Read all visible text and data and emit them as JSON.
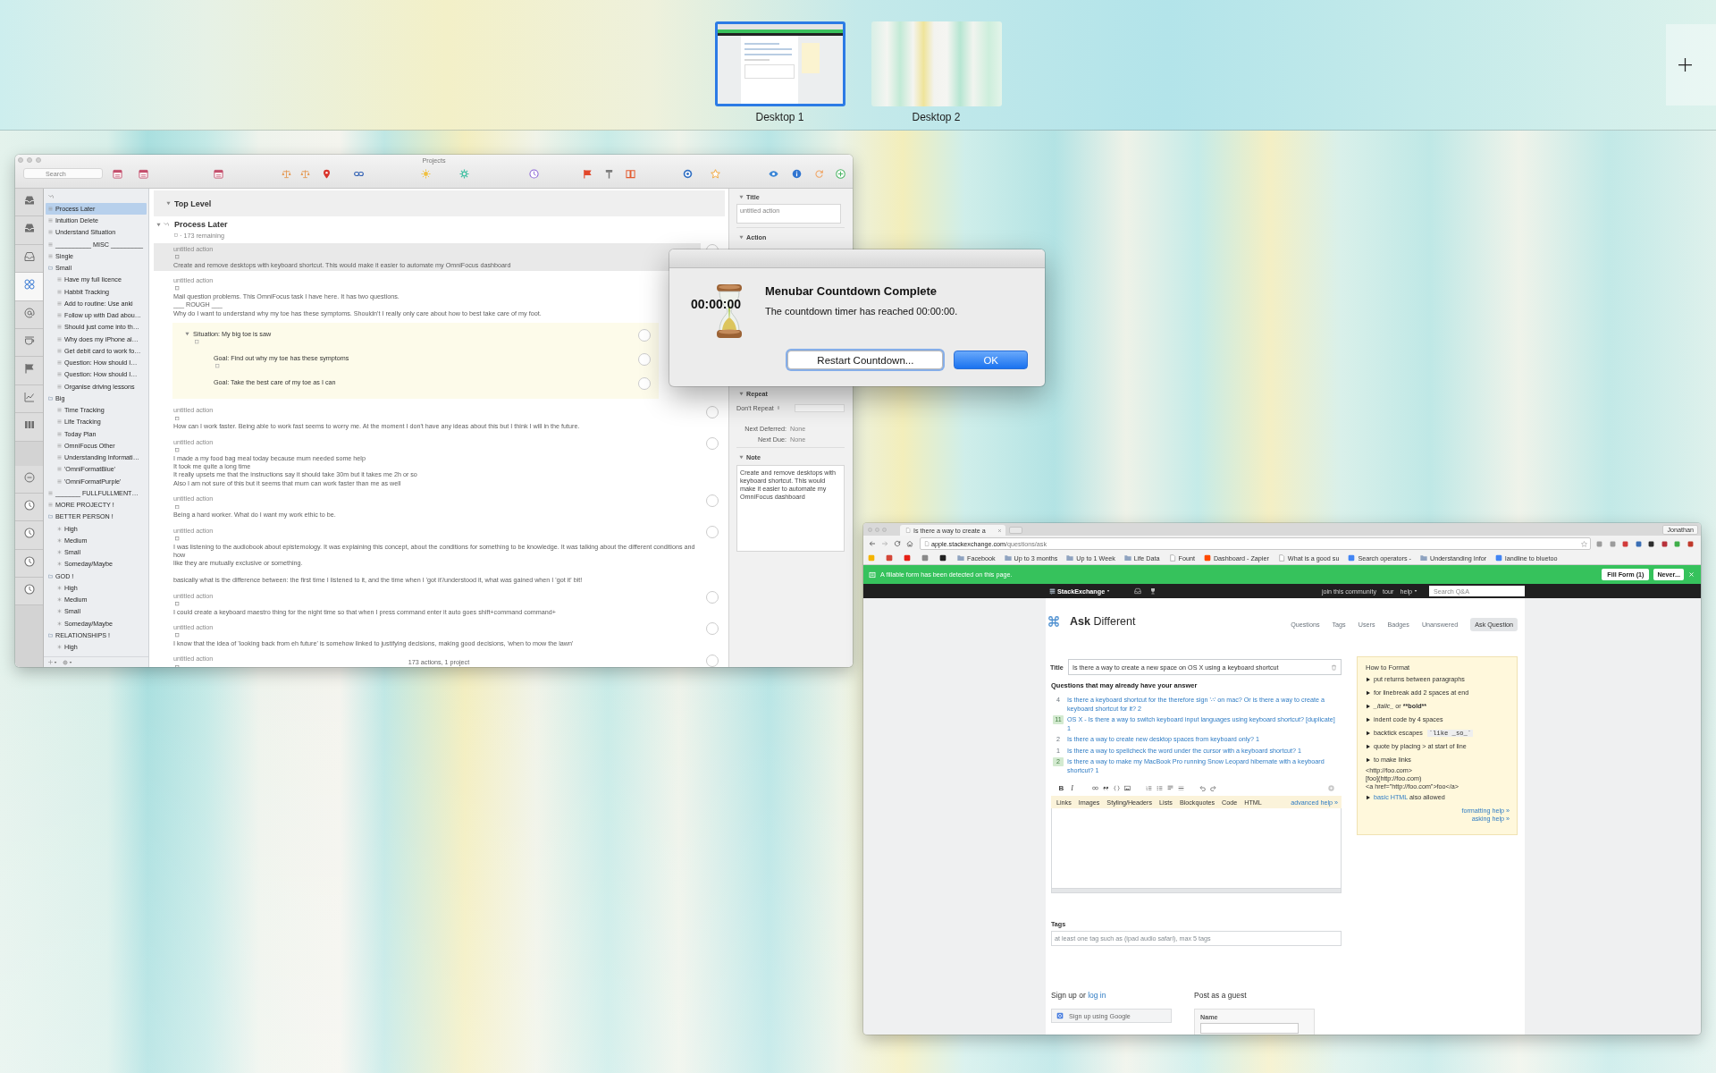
{
  "spaces": {
    "desktops": [
      {
        "label": "Desktop 1",
        "selected": true,
        "kind": "browser"
      },
      {
        "label": "Desktop 2",
        "selected": false,
        "kind": "wallpaper"
      }
    ]
  },
  "omnifocus": {
    "title": "Projects",
    "search_placeholder": "Search",
    "perspectives": [
      {
        "kind": "tray",
        "selected": false
      },
      {
        "kind": "tray",
        "selected": false
      },
      {
        "kind": "tray-outline",
        "selected": false
      },
      {
        "kind": "projects",
        "selected": true
      },
      {
        "kind": "contexts",
        "selected": false
      },
      {
        "kind": "forecast",
        "selected": false
      },
      {
        "kind": "flagged",
        "selected": false
      },
      {
        "kind": "review",
        "selected": false
      },
      {
        "kind": "columns",
        "selected": false
      }
    ],
    "custom_perspectives": [
      {
        "kind": "minus",
        "selected": false
      },
      {
        "kind": "clock",
        "selected": false
      },
      {
        "kind": "clock",
        "selected": false
      },
      {
        "kind": "clock",
        "selected": false
      },
      {
        "kind": "clock",
        "selected": false
      }
    ],
    "sidebar": [
      {
        "name": "Process Later",
        "kind": "project",
        "selected": true
      },
      {
        "name": "Intuition Delete",
        "kind": "project",
        "selected": false
      },
      {
        "name": "Understand Situation",
        "kind": "project",
        "selected": false
      },
      {
        "name": "__________ MISC _________",
        "kind": "project",
        "selected": false
      },
      {
        "name": "Single",
        "kind": "project",
        "selected": false
      },
      {
        "name": "Small",
        "kind": "folder",
        "selected": false,
        "children": [
          {
            "name": "Have my full licence",
            "kind": "project",
            "selected": false
          },
          {
            "name": "Habbit Tracking",
            "kind": "project",
            "selected": false
          },
          {
            "name": "Add to routine: Use anki",
            "kind": "project",
            "selected": false
          },
          {
            "name": "Follow up with Dad abou…",
            "kind": "project",
            "selected": false
          },
          {
            "name": "Should just come into th…",
            "kind": "project",
            "selected": false
          },
          {
            "name": "Why does my iPhone al…",
            "kind": "project",
            "selected": false
          },
          {
            "name": "Get debit card to work fo…",
            "kind": "project",
            "selected": false
          },
          {
            "name": "Question: How should I…",
            "kind": "project",
            "selected": false
          },
          {
            "name": "Question: How should I…",
            "kind": "project",
            "selected": false
          },
          {
            "name": "Organise driving lessons",
            "kind": "project",
            "selected": false
          }
        ]
      },
      {
        "name": "Big",
        "kind": "folder",
        "selected": false,
        "children": [
          {
            "name": "Time Tracking",
            "kind": "project",
            "selected": false
          },
          {
            "name": "Life Tracking",
            "kind": "project",
            "selected": false
          },
          {
            "name": "Today Plan",
            "kind": "project",
            "selected": false
          },
          {
            "name": "OmniFocus Other",
            "kind": "project",
            "selected": false
          },
          {
            "name": "Understanding Informati…",
            "kind": "project",
            "selected": false
          },
          {
            "name": "'OmniFormatBlue'",
            "kind": "project",
            "selected": false
          },
          {
            "name": "'OmniFormatPurple'",
            "kind": "project",
            "selected": false
          }
        ]
      },
      {
        "name": "_______ FULLFULLMENT…",
        "kind": "project",
        "selected": false
      },
      {
        "name": "MORE PROJECTY !",
        "kind": "project",
        "selected": false
      },
      {
        "name": "BETTER PERSON !",
        "kind": "folder",
        "selected": false,
        "children": [
          {
            "name": "High",
            "kind": "list",
            "selected": false
          },
          {
            "name": "Medium",
            "kind": "list",
            "selected": false
          },
          {
            "name": "Small",
            "kind": "list",
            "selected": false
          },
          {
            "name": "Someday/Maybe",
            "kind": "list",
            "selected": false
          }
        ]
      },
      {
        "name": "GOD !",
        "kind": "folder",
        "selected": false,
        "children": [
          {
            "name": "High",
            "kind": "list",
            "selected": false
          },
          {
            "name": "Medium",
            "kind": "list",
            "selected": false
          },
          {
            "name": "Small",
            "kind": "list",
            "selected": false
          },
          {
            "name": "Someday/Maybe",
            "kind": "list",
            "selected": false
          }
        ]
      },
      {
        "name": "RELATIONSHIPS !",
        "kind": "folder",
        "selected": false,
        "children": [
          {
            "name": "High",
            "kind": "list",
            "selected": false
          }
        ]
      }
    ],
    "outline": {
      "header": "Top Level",
      "project": "Process Later",
      "remaining": "· 173 remaining",
      "actions": [
        {
          "title": "untitled action",
          "selected": true,
          "checked": false,
          "attachment": true,
          "note": [
            [
              "Create and remove desktops with keyboard shortcut. This would make it easier to automate my OmniFocus dashboard"
            ]
          ]
        },
        {
          "title": "untitled action",
          "selected": false,
          "attachment": true,
          "note": [
            [
              "Mail question problems. This OmniFocus task I have here. It has two questions.",
              "___ ROUGH ___",
              "Why do I want to understand why my toe has these symptoms. Shouldn't I really only care about how to best take care of my foot."
            ]
          ],
          "children": [
            {
              "title": "Situation: My big toe is saw",
              "selected": false,
              "checked": false,
              "attachment": true,
              "expanded": true,
              "children": [
                {
                  "title": "Goal: Find out why my toe has these symptoms",
                  "selected": false,
                  "checked": false,
                  "attachment": true
                },
                {
                  "title": "Goal: Take the best care of my toe as I can",
                  "selected": false,
                  "checked": false,
                  "attachment": false
                }
              ]
            }
          ]
        },
        {
          "title": "untitled action",
          "selected": false,
          "checked": false,
          "attachment": true,
          "note": [
            [
              "How can I work faster. Being able to work fast seems to worry me. At the moment I don't have any ideas about this but I think I will in the future."
            ]
          ]
        },
        {
          "title": "untitled action",
          "selected": false,
          "checked": false,
          "attachment": true,
          "note": [
            [
              "I made a my food bag meal today because mum needed some help",
              "It took me quite a long time",
              "It really upsets me that the instructions say it should take 30m but it takes me 2h or so",
              "Also I am not sure of this but it seems that mum can work faster than me as well"
            ]
          ]
        },
        {
          "title": "untitled action",
          "selected": false,
          "checked": false,
          "attachment": true,
          "note": [
            [
              "Being a hard worker. What do I want my work ethic to be."
            ]
          ]
        },
        {
          "title": "untitled action",
          "selected": false,
          "checked": false,
          "attachment": true,
          "note": [
            [
              "I was listening to the audiobook about epistemology. It was explaining this concept, about the conditions for something to be knowledge. It was talking about the different conditions and how",
              "like they are mutually exclusive or something."
            ],
            [
              "basically what is the difference between: the first time I listened to it, and the time when I 'got it'/understood it, what was gained when I 'got it' bit!"
            ]
          ]
        },
        {
          "title": "untitled action",
          "selected": false,
          "checked": false,
          "attachment": true,
          "note": [
            [
              "I could create a keyboard maestro thing for the night time so that when I press command enter it auto goes shift+command command+"
            ]
          ]
        },
        {
          "title": "untitled action",
          "selected": false,
          "checked": false,
          "attachment": true,
          "note": [
            [
              "I know that the idea of 'looking back from eh future' is somehow linked to justifying decisions, making good decisions, 'when to mow the lawn'"
            ]
          ]
        },
        {
          "title": "untitled action",
          "selected": false,
          "checked": false,
          "attachment": true
        }
      ],
      "footer": "173 actions, 1 project"
    },
    "inspector": {
      "sections": [
        {
          "kind": "title",
          "heading": "Title",
          "placeholder": "untitled action"
        },
        {
          "kind": "action",
          "heading": "Action"
        },
        {
          "kind": "repeat",
          "heading": "Repeat",
          "repeat": "Don't Repeat",
          "rows": [
            {
              "label": "Next Deferred:",
              "value": "None"
            },
            {
              "label": "Next Due:",
              "value": "None"
            }
          ]
        },
        {
          "kind": "note",
          "heading": "Note",
          "text": "Create and remove desktops with keyboard shortcut. This would make it easier to automate my OmniFocus dashboard"
        }
      ]
    }
  },
  "dialog": {
    "timer": "00:00:00",
    "title": "Menubar Countdown Complete",
    "message": "The countdown timer has reached 00:00:00.",
    "buttons": [
      {
        "label": "Restart Countdown...",
        "default": false,
        "focused": true
      },
      {
        "label": "OK",
        "default": true,
        "focused": false
      }
    ]
  },
  "browser": {
    "tab": "Is there a way to create a",
    "profile": "Jonathan",
    "url_host": "apple.stackexchange.com",
    "url_path": "/questions/ask",
    "bookmarks": [
      {
        "kind": "site",
        "color": "#f4b400"
      },
      {
        "kind": "site",
        "color": "#d44638"
      },
      {
        "kind": "site",
        "color": "#e62117"
      },
      {
        "kind": "site",
        "color": "#8a8a8a"
      },
      {
        "kind": "site",
        "color": "#222222"
      },
      {
        "kind": "folder",
        "label": "Facebook"
      },
      {
        "kind": "folder",
        "label": "Up to 3 months"
      },
      {
        "kind": "folder",
        "label": "Up to 1 Week"
      },
      {
        "kind": "folder",
        "label": "Life Data"
      },
      {
        "kind": "page",
        "label": "Fount"
      },
      {
        "kind": "site",
        "color": "#ff4a00",
        "label": "Dashboard - Zapier"
      },
      {
        "kind": "page",
        "label": "What is a good su"
      },
      {
        "kind": "site",
        "color": "#4285f4",
        "label": "Search operators -"
      },
      {
        "kind": "folder",
        "label": "Understanding Infor"
      },
      {
        "kind": "site",
        "color": "#4285f4",
        "label": "landline to bluetoo"
      }
    ],
    "infobar": {
      "message": "A fillable form has been detected on this page.",
      "buttons": [
        "Fill Form (1)",
        "Never..."
      ]
    },
    "site_bar": {
      "brand": "StackExchange",
      "links": [
        {
          "label": "join this community",
          "menu": false
        },
        {
          "label": "tour",
          "menu": false
        },
        {
          "label": "help",
          "menu": true
        }
      ],
      "search_placeholder": "Search Q&A"
    },
    "site": {
      "name": "**Ask** Different",
      "nav": [
        {
          "label": "Questions",
          "selected": false
        },
        {
          "label": "Tags",
          "selected": false
        },
        {
          "label": "Users",
          "selected": false
        },
        {
          "label": "Badges",
          "selected": false
        },
        {
          "label": "Unanswered",
          "selected": false
        },
        {
          "label": "Ask Question",
          "selected": true
        }
      ],
      "title_label": "Title",
      "title_value": "Is there a way to create a new space on OS X using a keyboard shortcut",
      "similar_heading": "Questions that may already have your answer",
      "similar": [
        {
          "votes": "4",
          "accepted": false,
          "text": "Is there a keyboard shortcut for the therefore sign '∴' on mac? Or is there a way to create a keyboard shortcut for it? 2"
        },
        {
          "votes": "11",
          "accepted": true,
          "text": "OS X - Is there a way to switch keyboard input languages using keyboard shortcut? [duplicate] 1"
        },
        {
          "votes": "2",
          "accepted": false,
          "text": "Is there a way to create new desktop spaces from keyboard only? 1"
        },
        {
          "votes": "1",
          "accepted": false,
          "text": "Is there a way to spellcheck the word under the cursor with a keyboard shortcut? 1"
        },
        {
          "votes": "2",
          "accepted": true,
          "text": "Is there a way to make my MacBook Pro running Snow Leopard hibernate with a keyboard shortcut? 1"
        }
      ],
      "format_buttons": [
        {
          "kind": "bold",
          "label": "B"
        },
        {
          "kind": "italic",
          "label": "I"
        }
      ],
      "editor_tabs": [
        "Links",
        "Images",
        "Styling/Headers",
        "Lists",
        "Blockquotes",
        "Code",
        "HTML"
      ],
      "advanced_help": "advanced help »",
      "tags_label": "Tags",
      "tags_placeholder": "at least one tag such as (ipad audio safari), max 5 tags",
      "signup": {
        "text": "Sign up or",
        "link": "log in"
      },
      "google_button": "Sign up using Google",
      "guest_heading": "Post as a guest",
      "name_label": "Name",
      "format_help": {
        "title": "How to Format",
        "items": [
          {
            "kind": "tip",
            "parts": [
              {
                "kind": "text",
                "text": "put returns between paragraphs"
              }
            ]
          },
          {
            "kind": "tip",
            "parts": [
              {
                "kind": "text",
                "text": "for linebreak add 2 spaces at end"
              }
            ]
          },
          {
            "kind": "tip",
            "parts": [
              {
                "kind": "italic",
                "text": "_italic_"
              },
              {
                "kind": "text",
                "text": " or "
              },
              {
                "kind": "bold",
                "text": "**bold**"
              }
            ]
          },
          {
            "kind": "tip",
            "parts": [
              {
                "kind": "text",
                "text": "indent code by 4 spaces"
              }
            ]
          },
          {
            "kind": "tip",
            "parts": [
              {
                "kind": "text",
                "text": "backtick escapes"
              },
              {
                "kind": "code",
                "text": "`like _so_`"
              }
            ]
          },
          {
            "kind": "tip",
            "parts": [
              {
                "kind": "text",
                "text": "quote by placing > at start of line"
              }
            ]
          },
          {
            "kind": "tip",
            "parts": [
              {
                "kind": "text",
                "text": "to make links"
              }
            ]
          },
          {
            "kind": "example",
            "text": "<http://foo.com>"
          },
          {
            "kind": "example",
            "text": "[foo](http://foo.com)"
          },
          {
            "kind": "example",
            "text": "<a href=\"http://foo.com\">foo</a>"
          },
          {
            "kind": "tip",
            "parts": [
              {
                "kind": "link",
                "text": "basic HTML"
              },
              {
                "kind": "text",
                "text": " also allowed"
              }
            ]
          }
        ],
        "links": [
          "formatting help »",
          "asking help »"
        ]
      }
    }
  }
}
